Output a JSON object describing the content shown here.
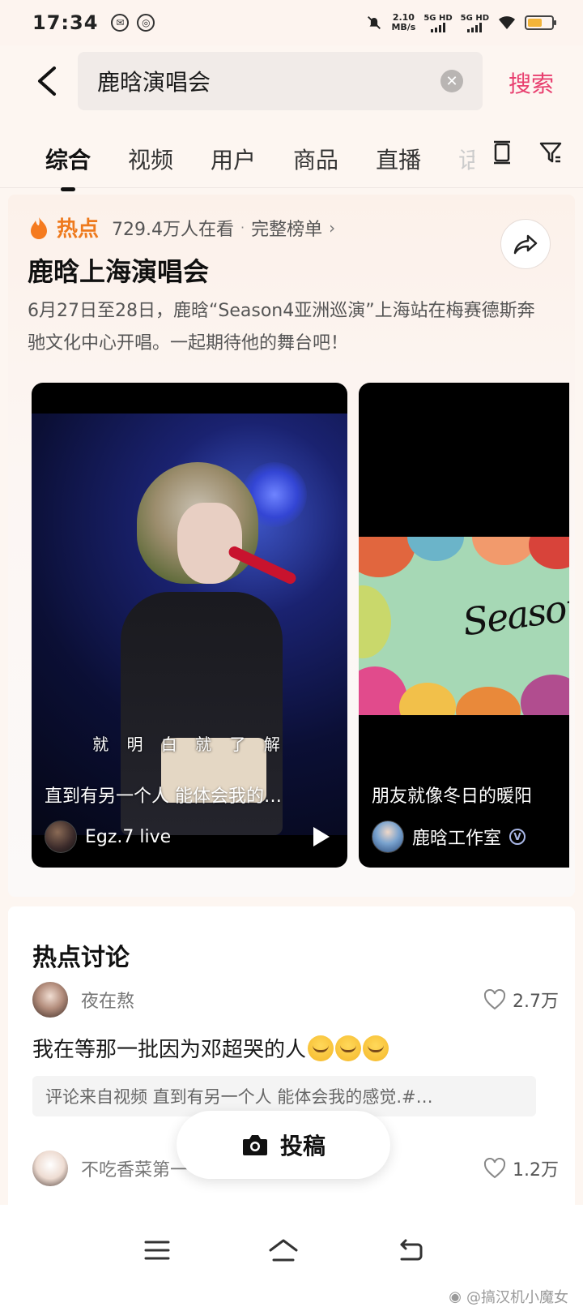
{
  "status_bar": {
    "time": "17:34",
    "speed_value": "2.10",
    "speed_unit": "MB/s",
    "signal1": "5G HD",
    "signal2": "5G HD"
  },
  "search": {
    "query": "鹿晗演唱会",
    "search_button": "搜索"
  },
  "tabs": [
    {
      "label": "综合"
    },
    {
      "label": "视频"
    },
    {
      "label": "用户"
    },
    {
      "label": "商品"
    },
    {
      "label": "直播"
    },
    {
      "label": "话"
    }
  ],
  "hot": {
    "label": "热点",
    "viewers": "729.4万人在看",
    "separator": "·",
    "rank_link": "完整榜单",
    "title": "鹿晗上海演唱会",
    "description": "6月27日至28日，鹿晗“Season4亚洲巡演”上海站在梅赛德斯奔驰文化中心开唱。一起期待他的舞台吧！"
  },
  "videos": [
    {
      "subtitle": "就 明 白 就 了 解",
      "title": "直到有另一个人 能体会我的…",
      "author": "Egz.7 live"
    },
    {
      "art_text": "Season",
      "title": "朋友就像冬日的暖阳",
      "author": "鹿晗工作室"
    }
  ],
  "discussion": {
    "title": "热点讨论",
    "comments": [
      {
        "user": "夜在熬",
        "likes": "2.7万",
        "text": "我在等那一批因为邓超哭的人",
        "source": "评论来自视频 直到有另一个人 能体会我的感觉.#…"
      },
      {
        "user": "不吃香菜第一",
        "likes": "1.2万"
      }
    ]
  },
  "post_button": "投稿",
  "watermark": "@搞汉机小魔女"
}
